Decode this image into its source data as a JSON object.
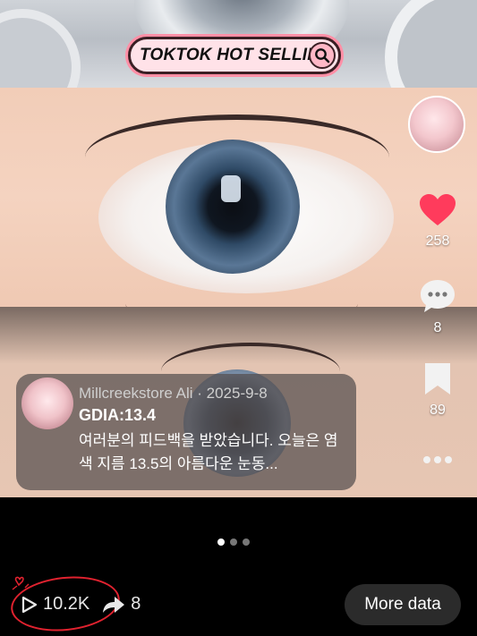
{
  "search": {
    "label": "TOKTOK HOT SELLING"
  },
  "actions": {
    "likes": "258",
    "comments": "8",
    "saves": "89"
  },
  "card": {
    "meta": "Millcreekstore Ali · 2025-9-8",
    "title": "GDIA:13.4",
    "body": "여러분의 피드백을 받았습니다. 오늘은 염색 지름 13.5의 아름다운 눈동..."
  },
  "carousel": {
    "pages": 3,
    "active": 1
  },
  "stats": {
    "views": "10.2K",
    "shares": "8"
  },
  "buttons": {
    "more_data": "More data"
  },
  "colors": {
    "heart": "#ff3b5c",
    "annotation_circle": "#e0222f",
    "search_border": "#ff8fa6"
  }
}
